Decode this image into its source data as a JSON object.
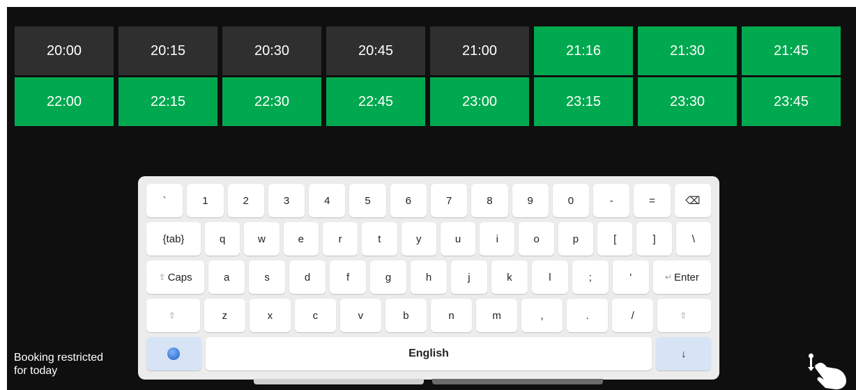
{
  "slots": {
    "row1": [
      {
        "time": "20:00",
        "status": "past"
      },
      {
        "time": "20:15",
        "status": "past"
      },
      {
        "time": "20:30",
        "status": "past"
      },
      {
        "time": "20:45",
        "status": "past"
      },
      {
        "time": "21:00",
        "status": "past"
      },
      {
        "time": "21:16",
        "status": "available"
      },
      {
        "time": "21:30",
        "status": "available"
      },
      {
        "time": "21:45",
        "status": "available"
      }
    ],
    "row2": [
      {
        "time": "22:00",
        "status": "available"
      },
      {
        "time": "22:15",
        "status": "available"
      },
      {
        "time": "22:30",
        "status": "available"
      },
      {
        "time": "22:45",
        "status": "available"
      },
      {
        "time": "23:00",
        "status": "available"
      },
      {
        "time": "23:15",
        "status": "available"
      },
      {
        "time": "23:30",
        "status": "available"
      },
      {
        "time": "23:45",
        "status": "available"
      }
    ]
  },
  "colors": {
    "past": "#2f2f2f",
    "available": "#00a94f"
  },
  "keyboard": {
    "row1": [
      "`",
      "1",
      "2",
      "3",
      "4",
      "5",
      "6",
      "7",
      "8",
      "9",
      "0",
      "-",
      "=",
      "⌫"
    ],
    "row2": [
      "{tab}",
      "q",
      "w",
      "e",
      "r",
      "t",
      "y",
      "u",
      "i",
      "o",
      "p",
      "[",
      "]",
      "\\"
    ],
    "row3": {
      "caps_icon": "⇧",
      "caps_label": "Caps",
      "keys": [
        "a",
        "s",
        "d",
        "f",
        "g",
        "h",
        "j",
        "k",
        "l",
        ";",
        "'"
      ],
      "enter_icon": "↵",
      "enter_label": "Enter"
    },
    "row4": {
      "shift_left": "⇧",
      "keys": [
        "z",
        "x",
        "c",
        "v",
        "b",
        "n",
        "m",
        ",",
        ".",
        "/"
      ],
      "shift_right": "⇧"
    },
    "row5": {
      "globe_icon": "globe-icon",
      "space_label": "English",
      "hide_label": "↓"
    }
  },
  "status": {
    "line1": "Booking restricted",
    "line2": "for today"
  },
  "icons": {
    "touch": "touch-hand-icon"
  }
}
